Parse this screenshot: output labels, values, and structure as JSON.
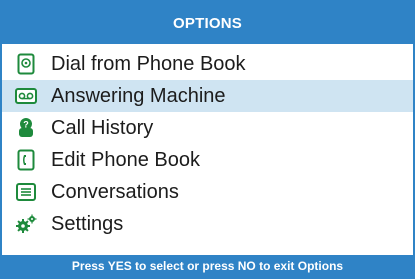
{
  "header": {
    "title": "OPTIONS"
  },
  "menu": {
    "items": [
      {
        "label": "Dial from Phone Book",
        "icon": "phone-book-dial-icon"
      },
      {
        "label": "Answering Machine",
        "icon": "answering-machine-icon",
        "selected": true
      },
      {
        "label": "Call History",
        "icon": "call-history-icon"
      },
      {
        "label": "Edit Phone Book",
        "icon": "edit-phone-book-icon"
      },
      {
        "label": "Conversations",
        "icon": "conversations-icon"
      },
      {
        "label": "Settings",
        "icon": "settings-icon"
      }
    ]
  },
  "footer": {
    "hint": "Press YES to select or press NO to exit Options"
  },
  "colors": {
    "accent": "#2f83c6",
    "selected_row": "#cfe4f2",
    "icon_green": "#1e8a3c"
  }
}
